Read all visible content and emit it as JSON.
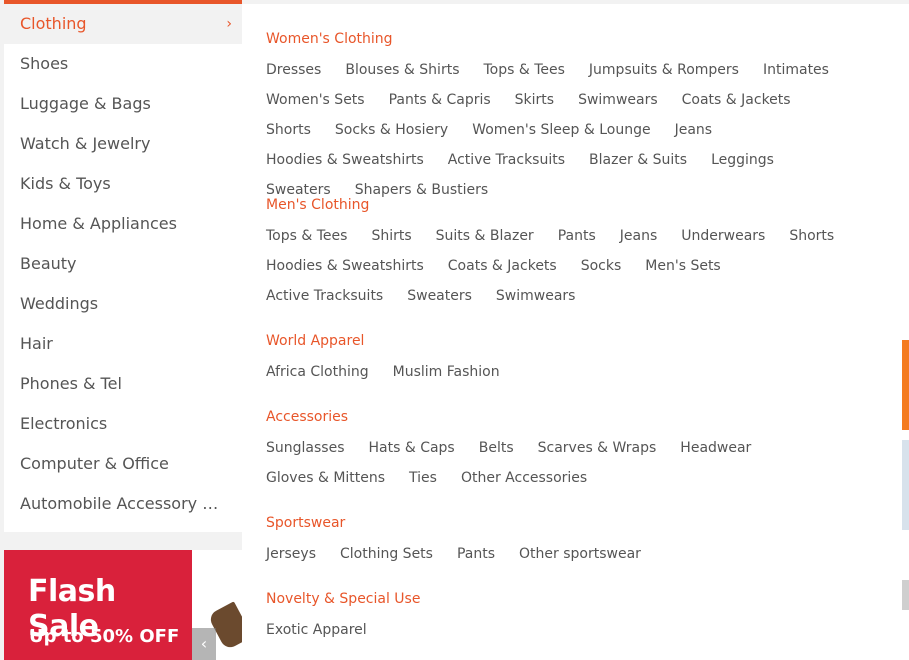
{
  "sidebar": {
    "items": [
      {
        "label": "Clothing",
        "active": true
      },
      {
        "label": "Shoes"
      },
      {
        "label": "Luggage & Bags"
      },
      {
        "label": "Watch & Jewelry"
      },
      {
        "label": "Kids & Toys"
      },
      {
        "label": "Home & Appliances"
      },
      {
        "label": "Beauty"
      },
      {
        "label": "Weddings"
      },
      {
        "label": "Hair"
      },
      {
        "label": "Phones & Tel"
      },
      {
        "label": "Electronics"
      },
      {
        "label": "Computer & Office"
      },
      {
        "label": "Automobile Accessory &..."
      }
    ],
    "active_chevron": "›"
  },
  "mega_menu": {
    "groups": [
      {
        "title": "Women's Clothing",
        "links": [
          "Dresses",
          "Blouses & Shirts",
          "Tops & Tees",
          "Jumpsuits & Rompers",
          "Intimates",
          "Women's Sets",
          "Pants & Capris",
          "Skirts",
          "Swimwears",
          "Coats & Jackets",
          "Shorts",
          "Socks & Hosiery",
          "Women's Sleep & Lounge",
          "Jeans",
          "Hoodies & Sweatshirts",
          "Active Tracksuits",
          "Blazer & Suits",
          "Leggings",
          "Sweaters",
          "Shapers & Bustiers"
        ]
      },
      {
        "title": "Men's Clothing",
        "links": [
          "Tops & Tees",
          "Shirts",
          "Suits & Blazer",
          "Pants",
          "Jeans",
          "Underwears",
          "Shorts",
          "Hoodies & Sweatshirts",
          "Coats & Jackets",
          "Socks",
          "Men's Sets",
          "Active Tracksuits",
          "Sweaters",
          "Swimwears"
        ]
      },
      {
        "title": "World Apparel",
        "links": [
          "Africa Clothing",
          "Muslim Fashion"
        ]
      },
      {
        "title": "Accessories",
        "links": [
          "Sunglasses",
          "Hats & Caps",
          "Belts",
          "Scarves & Wraps",
          "Headwear",
          "Gloves & Mittens",
          "Ties",
          "Other Accessories"
        ]
      },
      {
        "title": "Sportswear",
        "links": [
          "Jerseys",
          "Clothing Sets",
          "Pants",
          "Other sportswear"
        ]
      },
      {
        "title": "Novelty & Special Use",
        "links": [
          "Exotic Apparel"
        ]
      }
    ]
  },
  "flash_sale": {
    "title": "Flash Sale",
    "subtitle": "Up to 50% OFF",
    "prev_arrow": "‹"
  },
  "colors": {
    "accent": "#e8562a",
    "flash_bg": "#d9213b",
    "link_text": "#555555"
  }
}
